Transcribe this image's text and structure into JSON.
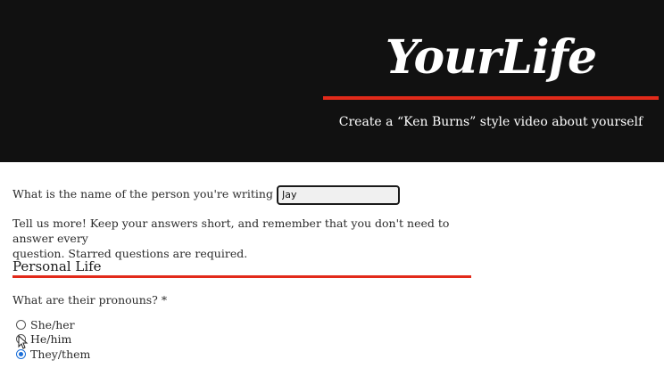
{
  "header": {
    "brand": "YourLife",
    "tagline": "Create a “Ken Burns” style video about yourself",
    "accent_color": "#e22a1a",
    "background_color": "#111111"
  },
  "form": {
    "name_question": "What is the name of the person you're writing about? *",
    "name_value": "Jay",
    "intro_line1": "Tell us more! Keep your answers short, and remember that you don't need to answer every",
    "intro_line2": "question. Starred questions are required.",
    "section_title": "Personal Life",
    "pronouns_question": "What are their pronouns? *",
    "pronoun_options": [
      {
        "label": "She/her",
        "checked": false
      },
      {
        "label": "He/him",
        "checked": false
      },
      {
        "label": "They/them",
        "checked": true
      }
    ]
  }
}
